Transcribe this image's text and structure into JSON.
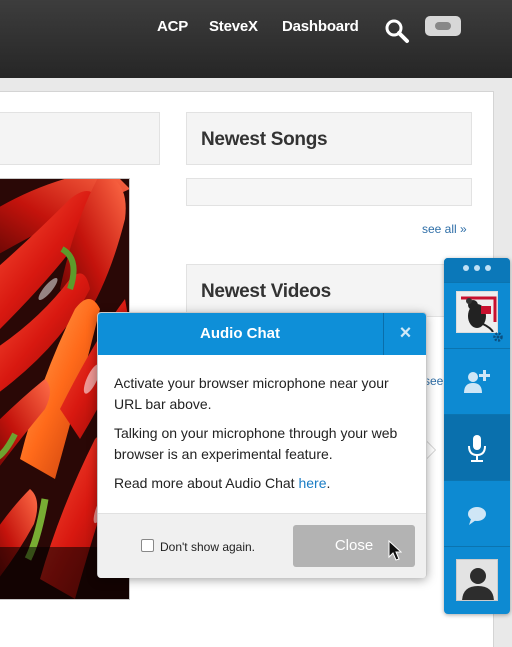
{
  "topbar": {
    "links": [
      "ACP",
      "SteveX",
      "Dashboard"
    ],
    "icons": [
      "search-icon",
      "toggle-pill"
    ]
  },
  "sections": {
    "songs_title": "Newest Songs",
    "see_all": "see all »",
    "videos_title": "Newest Videos",
    "videos_see_partial": "see"
  },
  "popup": {
    "title": "Audio Chat",
    "close_glyph": "×",
    "paragraph1": "Activate your browser microphone near your URL bar above.",
    "paragraph2": "Talking on your microphone through your web browser is an experimental feature.",
    "paragraph3_prefix": "Read more about Audio Chat ",
    "paragraph3_link": "here",
    "paragraph3_suffix": ".",
    "dont_show_label": "Don't show again.",
    "dont_show_checked": false,
    "close_button": "Close"
  },
  "sidebar": {
    "icons": [
      "settings-icon",
      "add-user-icon",
      "microphone-icon",
      "chat-bubble-icon"
    ],
    "active": "microphone-icon"
  },
  "colors": {
    "accent": "#0e8fd8",
    "topbar": "#2e2e2e",
    "link": "#2f6fa8",
    "close_button": "#b3b3b3"
  }
}
